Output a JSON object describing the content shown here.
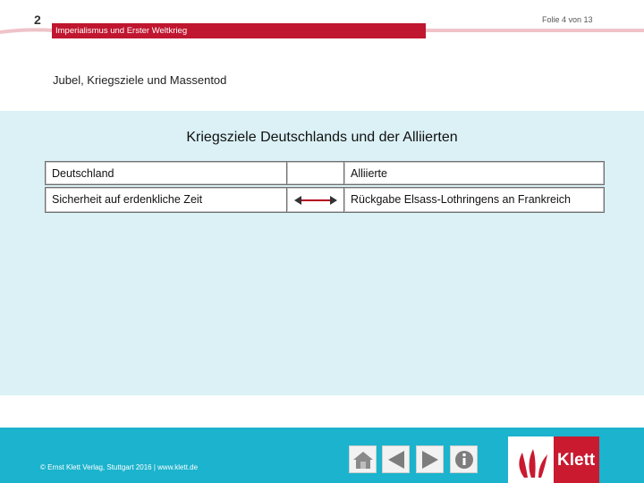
{
  "header": {
    "chapter_number": "2",
    "slide_counter": "Folie 4 von 13",
    "chapter_title": "Imperialismus und Erster Weltkrieg",
    "accent_color": "#c0162f"
  },
  "section_heading": "Jubel, Kriegsziele und Massentod",
  "panel": {
    "title": "Kriegsziele Deutschlands und der Alliierten",
    "background": "#dbf1f6",
    "table": {
      "header_left": "Deutschland",
      "header_center": "",
      "header_right": "Alliierte",
      "row_left": "Sicherheit auf erdenkliche Zeit",
      "row_center_icon": "double-arrow-icon",
      "row_right": "Rückgabe Elsass-Lothringens an Frankreich"
    }
  },
  "footer": {
    "background": "#1bb3cd",
    "copyright": "© Ernst Klett Verlag, Stuttgart 2016 | www.klett.de",
    "nav_icons": [
      "home-icon",
      "previous-icon",
      "next-icon",
      "info-icon"
    ],
    "brand_name": "Klett",
    "brand_color": "#c91a30"
  }
}
